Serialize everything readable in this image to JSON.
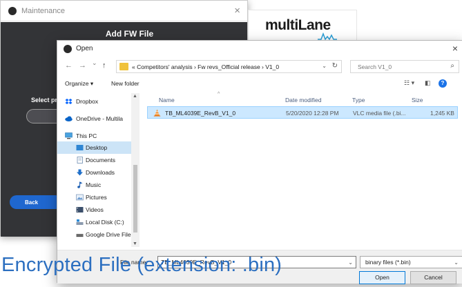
{
  "maintenance": {
    "title": "Maintenance",
    "header": "Add FW File",
    "select_label": "Select prov",
    "back_label": "Back",
    "close_glyph": "×"
  },
  "brand": {
    "name": "multiLane"
  },
  "dialog": {
    "title": "Open",
    "close_glyph": "×",
    "nav": {
      "back_glyph": "←",
      "forward_glyph": "→",
      "recent_glyph": "⌄",
      "up_glyph": "↑"
    },
    "address_path": "« Competitors' analysis  ›  Fw revs_Official release  ›  V1_0",
    "address_dropdown_glyph": "⌄",
    "refresh_glyph": "↻",
    "search_placeholder": "Search V1_0",
    "search_glyph": "⌕",
    "toolbar": {
      "organize": "Organize ▾",
      "new_folder": "New folder",
      "view_glyph": "☷ ▾",
      "pane_glyph": "◧",
      "help_glyph": "?"
    },
    "sidebar": {
      "items": [
        {
          "label": "Dropbox",
          "icon": "dropbox-icon"
        },
        {
          "label": "OneDrive - Multila",
          "icon": "onedrive-icon"
        },
        {
          "label": "This PC",
          "icon": "computer-icon"
        },
        {
          "label": "Desktop",
          "icon": "desktop-icon",
          "selected": true
        },
        {
          "label": "Documents",
          "icon": "documents-icon"
        },
        {
          "label": "Downloads",
          "icon": "downloads-icon"
        },
        {
          "label": "Music",
          "icon": "music-icon"
        },
        {
          "label": "Pictures",
          "icon": "pictures-icon"
        },
        {
          "label": "Videos",
          "icon": "videos-icon"
        },
        {
          "label": "Local Disk (C:)",
          "icon": "local-disk-icon"
        },
        {
          "label": "Google Drive File",
          "icon": "google-drive-icon"
        }
      ],
      "scroll_up_glyph": "▲",
      "scroll_down_glyph": "▼"
    },
    "columns": {
      "name": "Name",
      "date": "Date modified",
      "type": "Type",
      "size": "Size",
      "sort_glyph": "^"
    },
    "files": [
      {
        "name": "TB_ML4039E_RevB_V1_0",
        "date": "5/20/2020 12:28 PM",
        "type": "VLC media file (.bi...",
        "size": "1,245 KB",
        "icon": "vlc-icon"
      }
    ],
    "file_name_label": "File name:",
    "file_name_value": "TB_ML4039E_RevB_V1_0",
    "file_type_value": "binary files (*.bin)",
    "dropdown_glyph": "⌄",
    "open_label": "Open",
    "cancel_label": "Cancel"
  },
  "caption": "Encrypted File (extension: .bin)",
  "colors": {
    "accent": "#1f67cf",
    "caption": "#2c6fc0",
    "dark_panel": "#333437",
    "selection": "#cce8ff"
  }
}
